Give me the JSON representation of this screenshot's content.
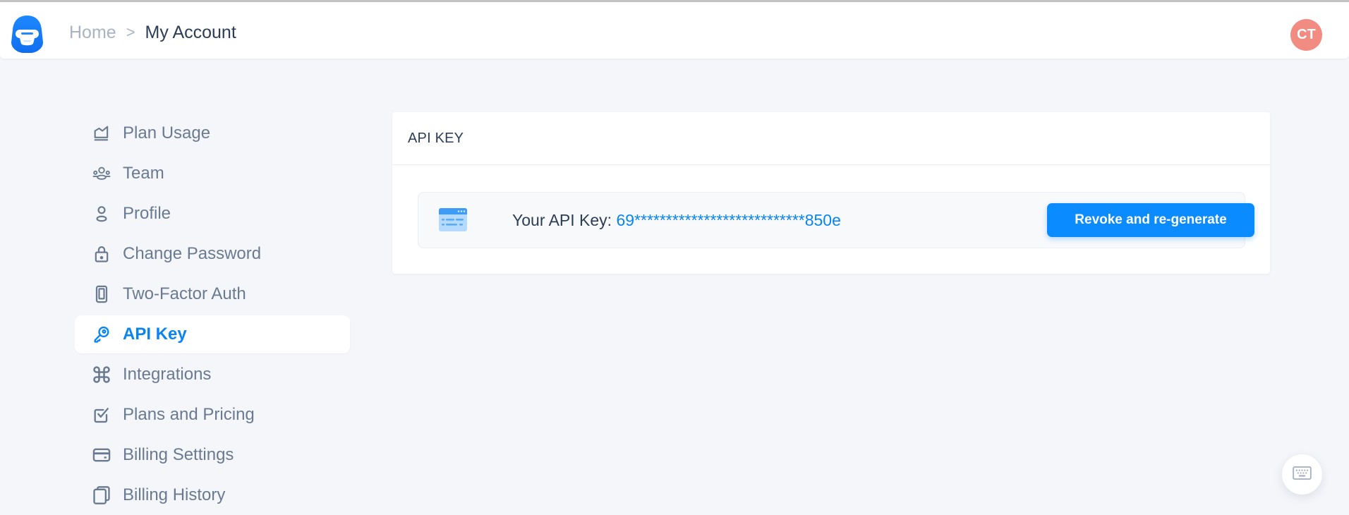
{
  "header": {
    "logo": "app-logo",
    "breadcrumb": {
      "home": "Home",
      "separator": ">",
      "current": "My Account"
    },
    "avatar_initials": "CT",
    "avatar_color": "#f28b82"
  },
  "sidebar": {
    "items": [
      {
        "label": "Plan Usage",
        "icon": "chart-area-icon",
        "active": false
      },
      {
        "label": "Team",
        "icon": "team-icon",
        "active": false
      },
      {
        "label": "Profile",
        "icon": "user-icon",
        "active": false
      },
      {
        "label": "Change Password",
        "icon": "lock-icon",
        "active": false
      },
      {
        "label": "Two-Factor Auth",
        "icon": "phone-icon",
        "active": false
      },
      {
        "label": "API Key",
        "icon": "key-icon",
        "active": true
      },
      {
        "label": "Integrations",
        "icon": "command-icon",
        "active": false
      },
      {
        "label": "Plans and Pricing",
        "icon": "checkbox-icon",
        "active": false
      },
      {
        "label": "Billing Settings",
        "icon": "credit-card-icon",
        "active": false
      },
      {
        "label": "Billing History",
        "icon": "copy-icon",
        "active": false
      }
    ]
  },
  "main": {
    "card_title": "API KEY",
    "key_label": "Your API Key: ",
    "key_value": "69***************************850e",
    "regenerate_label": "Revoke and re-generate"
  },
  "colors": {
    "accent": "#0a84f0",
    "button": "#0a8bff",
    "background": "#f4f6fa",
    "nav_text": "#6a7a90",
    "heading_text": "#2c3e55"
  },
  "floating": {
    "keyboard_icon": "keyboard-icon"
  }
}
